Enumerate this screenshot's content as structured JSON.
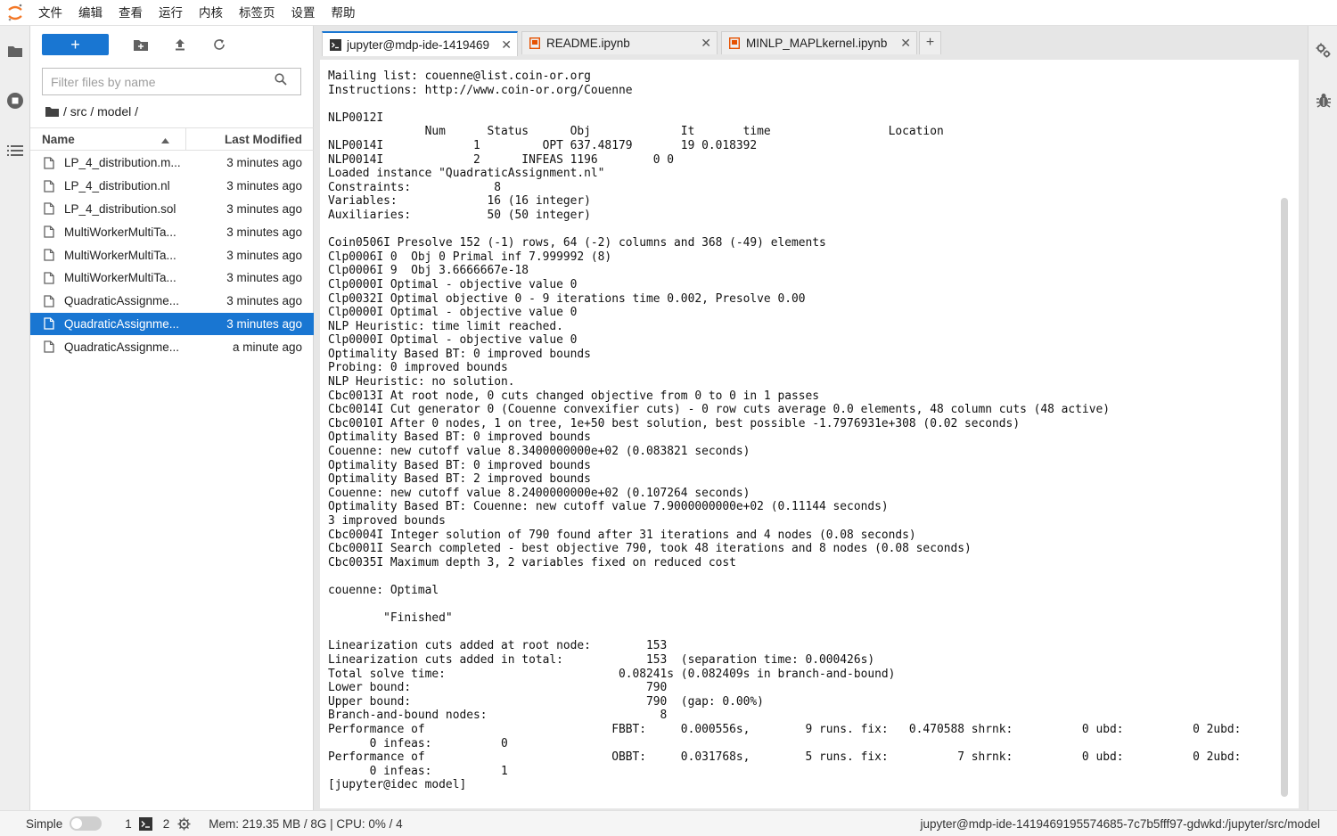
{
  "menubar": {
    "items": [
      "文件",
      "编辑",
      "查看",
      "运行",
      "内核",
      "标签页",
      "设置",
      "帮助"
    ]
  },
  "file_browser": {
    "new_button_label": "+",
    "filter_placeholder": "Filter files by name",
    "breadcrumb": "/ src / model /",
    "col_name": "Name",
    "col_modified": "Last Modified",
    "files": [
      {
        "name": "LP_4_distribution.m...",
        "modified": "3 minutes ago",
        "selected": false
      },
      {
        "name": "LP_4_distribution.nl",
        "modified": "3 minutes ago",
        "selected": false
      },
      {
        "name": "LP_4_distribution.sol",
        "modified": "3 minutes ago",
        "selected": false
      },
      {
        "name": "MultiWorkerMultiTa...",
        "modified": "3 minutes ago",
        "selected": false
      },
      {
        "name": "MultiWorkerMultiTa...",
        "modified": "3 minutes ago",
        "selected": false
      },
      {
        "name": "MultiWorkerMultiTa...",
        "modified": "3 minutes ago",
        "selected": false
      },
      {
        "name": "QuadraticAssignme...",
        "modified": "3 minutes ago",
        "selected": false
      },
      {
        "name": "QuadraticAssignme...",
        "modified": "3 minutes ago",
        "selected": true
      },
      {
        "name": "QuadraticAssignme...",
        "modified": "a minute ago",
        "selected": false
      }
    ]
  },
  "tabs": [
    {
      "label": "jupyter@mdp-ide-1419469",
      "active": true,
      "close": "✕"
    },
    {
      "label": "README.ipynb",
      "active": false,
      "close": "✕"
    },
    {
      "label": "MINLP_MAPLkernel.ipynb",
      "active": false,
      "close": "✕"
    }
  ],
  "add_tab_label": "+",
  "terminal_lines": [
    "Mailing list: couenne@list.coin-or.org",
    "Instructions: http://www.coin-or.org/Couenne",
    "",
    "NLP0012I",
    "              Num      Status      Obj             It       time                 Location",
    "NLP0014I             1         OPT 637.48179       19 0.018392",
    "NLP0014I             2      INFEAS 1196        0 0",
    "Loaded instance \"QuadraticAssignment.nl\"",
    "Constraints:            8",
    "Variables:             16 (16 integer)",
    "Auxiliaries:           50 (50 integer)",
    "",
    "Coin0506I Presolve 152 (-1) rows, 64 (-2) columns and 368 (-49) elements",
    "Clp0006I 0  Obj 0 Primal inf 7.999992 (8)",
    "Clp0006I 9  Obj 3.6666667e-18",
    "Clp0000I Optimal - objective value 0",
    "Clp0032I Optimal objective 0 - 9 iterations time 0.002, Presolve 0.00",
    "Clp0000I Optimal - objective value 0",
    "NLP Heuristic: time limit reached.",
    "Clp0000I Optimal - objective value 0",
    "Optimality Based BT: 0 improved bounds",
    "Probing: 0 improved bounds",
    "NLP Heuristic: no solution.",
    "Cbc0013I At root node, 0 cuts changed objective from 0 to 0 in 1 passes",
    "Cbc0014I Cut generator 0 (Couenne convexifier cuts) - 0 row cuts average 0.0 elements, 48 column cuts (48 active)",
    "Cbc0010I After 0 nodes, 1 on tree, 1e+50 best solution, best possible -1.7976931e+308 (0.02 seconds)",
    "Optimality Based BT: 0 improved bounds",
    "Couenne: new cutoff value 8.3400000000e+02 (0.083821 seconds)",
    "Optimality Based BT: 0 improved bounds",
    "Optimality Based BT: 2 improved bounds",
    "Couenne: new cutoff value 8.2400000000e+02 (0.107264 seconds)",
    "Optimality Based BT: Couenne: new cutoff value 7.9000000000e+02 (0.11144 seconds)",
    "3 improved bounds",
    "Cbc0004I Integer solution of 790 found after 31 iterations and 4 nodes (0.08 seconds)",
    "Cbc0001I Search completed - best objective 790, took 48 iterations and 8 nodes (0.08 seconds)",
    "Cbc0035I Maximum depth 3, 2 variables fixed on reduced cost",
    "",
    "couenne: Optimal",
    "",
    "        \"Finished\"",
    "",
    "Linearization cuts added at root node:        153",
    "Linearization cuts added in total:            153  (separation time: 0.000426s)",
    "Total solve time:                         0.08241s (0.082409s in branch-and-bound)",
    "Lower bound:                                  790",
    "Upper bound:                                  790  (gap: 0.00%)",
    "Branch-and-bound nodes:                         8",
    "Performance of                           FBBT:     0.000556s,        9 runs. fix:   0.470588 shrnk:          0 ubd:          0 2ubd:",
    "      0 infeas:          0",
    "Performance of                           OBBT:     0.031768s,        5 runs. fix:          7 shrnk:          0 ubd:          0 2ubd:",
    "      0 infeas:          1",
    "[jupyter@idec model]"
  ],
  "statusbar": {
    "mode_label": "Simple",
    "terminals_count": "1",
    "kernels_count": "2",
    "memory": "Mem: 219.35 MB / 8G | CPU: 0% / 4",
    "path": "jupyter@mdp-ide-1419469195574685-7c7b5fff97-gdwkd:/jupyter/src/model"
  },
  "colors": {
    "accent": "#1976d2",
    "notebook_icon": "#e65100",
    "logo": "#f37726"
  },
  "icons": {
    "left_sidebar": [
      "folder-icon",
      "running-stop-icon",
      "table-of-contents-icon"
    ],
    "right_sidebar": [
      "property-inspector-icon",
      "debugger-icon"
    ],
    "toolbar": [
      "new-folder-icon",
      "upload-icon",
      "refresh-icon"
    ]
  }
}
